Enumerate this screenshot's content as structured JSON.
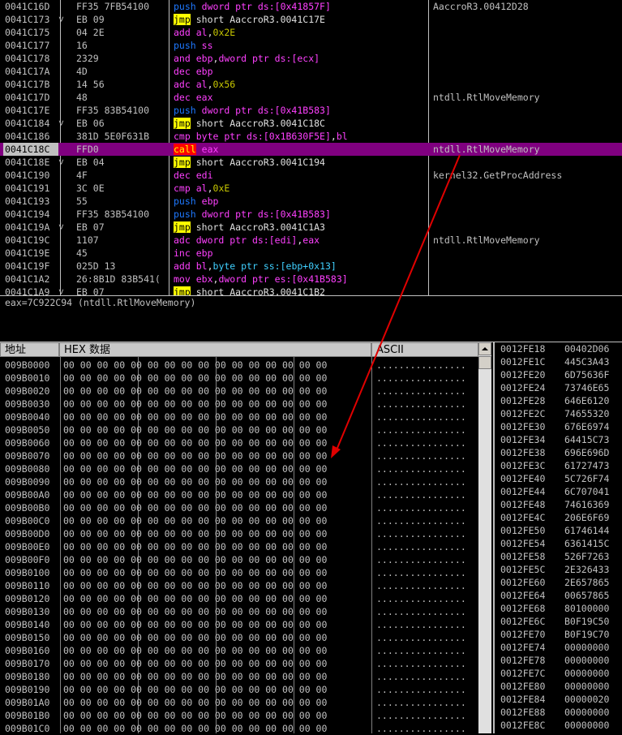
{
  "disasm": {
    "rows": [
      {
        "addr": "0041C16D",
        "mark": "",
        "hex": "FF35 7FB54100",
        "mn": "push",
        "mnc": "push",
        "ops": [
          [
            "mem",
            "dword ptr ds:[0x41857F]"
          ]
        ],
        "cmt": "AaccroR3.00412D28",
        "sel": false
      },
      {
        "addr": "0041C173",
        "mark": "˅",
        "hex": "EB 09",
        "mn": "jmp",
        "mnc": "jmp",
        "ops": [
          [
            "txt",
            "short AaccroR3.0041C17E"
          ]
        ],
        "cmt": "",
        "sel": false
      },
      {
        "addr": "0041C175",
        "mark": "",
        "hex": "04 2E",
        "mn": "add",
        "mnc": "",
        "ops": [
          [
            "reg",
            "al"
          ],
          [
            "txt",
            ","
          ],
          [
            "imm",
            "0x2E"
          ]
        ],
        "cmt": "",
        "sel": false
      },
      {
        "addr": "0041C177",
        "mark": "",
        "hex": "16",
        "mn": "push",
        "mnc": "push",
        "ops": [
          [
            "reg",
            "ss"
          ]
        ],
        "cmt": "",
        "sel": false
      },
      {
        "addr": "0041C178",
        "mark": "",
        "hex": "2329",
        "mn": "and",
        "mnc": "",
        "ops": [
          [
            "reg",
            "ebp"
          ],
          [
            "txt",
            ","
          ],
          [
            "mem",
            "dword ptr ds:[ecx]"
          ]
        ],
        "cmt": "",
        "sel": false
      },
      {
        "addr": "0041C17A",
        "mark": "",
        "hex": "4D",
        "mn": "dec",
        "mnc": "",
        "ops": [
          [
            "reg",
            "ebp"
          ]
        ],
        "cmt": "",
        "sel": false
      },
      {
        "addr": "0041C17B",
        "mark": "",
        "hex": "14 56",
        "mn": "adc",
        "mnc": "",
        "ops": [
          [
            "reg",
            "al"
          ],
          [
            "txt",
            ","
          ],
          [
            "imm",
            "0x56"
          ]
        ],
        "cmt": "",
        "sel": false
      },
      {
        "addr": "0041C17D",
        "mark": "",
        "hex": "48",
        "mn": "dec",
        "mnc": "",
        "ops": [
          [
            "reg",
            "eax"
          ]
        ],
        "cmt": "ntdll.RtlMoveMemory",
        "sel": false
      },
      {
        "addr": "0041C17E",
        "mark": "",
        "hex": "FF35 83B54100",
        "mn": "push",
        "mnc": "push",
        "ops": [
          [
            "mem",
            "dword ptr ds:[0x41B583]"
          ]
        ],
        "cmt": "",
        "sel": false
      },
      {
        "addr": "0041C184",
        "mark": "˅",
        "hex": "EB 06",
        "mn": "jmp",
        "mnc": "jmp",
        "ops": [
          [
            "txt",
            "short AaccroR3.0041C18C"
          ]
        ],
        "cmt": "",
        "sel": false
      },
      {
        "addr": "0041C186",
        "mark": "",
        "hex": "381D 5E0F631B",
        "mn": "cmp",
        "mnc": "",
        "ops": [
          [
            "mem",
            "byte ptr ds:[0x1B630F5E]"
          ],
          [
            "txt",
            ","
          ],
          [
            "reg",
            "bl"
          ]
        ],
        "cmt": "",
        "sel": false
      },
      {
        "addr": "0041C18C",
        "mark": "",
        "hex": "FFD0",
        "mn": "call",
        "mnc": "call",
        "ops": [
          [
            "reg",
            "eax"
          ]
        ],
        "cmt": "ntdll.RtlMoveMemory",
        "sel": true
      },
      {
        "addr": "0041C18E",
        "mark": "˅",
        "hex": "EB 04",
        "mn": "jmp",
        "mnc": "jmp",
        "ops": [
          [
            "txt",
            "short AaccroR3.0041C194"
          ]
        ],
        "cmt": "",
        "sel": false
      },
      {
        "addr": "0041C190",
        "mark": "",
        "hex": "4F",
        "mn": "dec",
        "mnc": "",
        "ops": [
          [
            "reg",
            "edi"
          ]
        ],
        "cmt": "kernel32.GetProcAddress",
        "sel": false
      },
      {
        "addr": "0041C191",
        "mark": "",
        "hex": "3C 0E",
        "mn": "cmp",
        "mnc": "",
        "ops": [
          [
            "reg",
            "al"
          ],
          [
            "txt",
            ","
          ],
          [
            "imm",
            "0xE"
          ]
        ],
        "cmt": "",
        "sel": false
      },
      {
        "addr": "0041C193",
        "mark": "",
        "hex": "55",
        "mn": "push",
        "mnc": "push",
        "ops": [
          [
            "reg",
            "ebp"
          ]
        ],
        "cmt": "",
        "sel": false
      },
      {
        "addr": "0041C194",
        "mark": "",
        "hex": "FF35 83B54100",
        "mn": "push",
        "mnc": "push",
        "ops": [
          [
            "mem",
            "dword ptr ds:[0x41B583]"
          ]
        ],
        "cmt": "",
        "sel": false
      },
      {
        "addr": "0041C19A",
        "mark": "˅",
        "hex": "EB 07",
        "mn": "jmp",
        "mnc": "jmp",
        "ops": [
          [
            "txt",
            "short AaccroR3.0041C1A3"
          ]
        ],
        "cmt": "",
        "sel": false
      },
      {
        "addr": "0041C19C",
        "mark": "",
        "hex": "1107",
        "mn": "adc",
        "mnc": "",
        "ops": [
          [
            "mem",
            "dword ptr ds:[edi]"
          ],
          [
            "txt",
            ","
          ],
          [
            "reg",
            "eax"
          ]
        ],
        "cmt": "ntdll.RtlMoveMemory",
        "sel": false
      },
      {
        "addr": "0041C19E",
        "mark": "",
        "hex": "45",
        "mn": "inc",
        "mnc": "",
        "ops": [
          [
            "reg",
            "ebp"
          ]
        ],
        "cmt": "",
        "sel": false
      },
      {
        "addr": "0041C19F",
        "mark": "",
        "hex": "025D 13",
        "mn": "add",
        "mnc": "",
        "ops": [
          [
            "reg",
            "bl"
          ],
          [
            "txt",
            ","
          ],
          [
            "cyan",
            "byte ptr ss:[ebp+0x13]"
          ]
        ],
        "cmt": "",
        "sel": false
      },
      {
        "addr": "0041C1A2",
        "mark": "",
        "hex": "26:8B1D 83B541(",
        "mn": "mov",
        "mnc": "",
        "ops": [
          [
            "reg",
            "ebx"
          ],
          [
            "txt",
            ","
          ],
          [
            "mem",
            "dword ptr es:[0x41B583]"
          ]
        ],
        "cmt": "",
        "sel": false
      },
      {
        "addr": "0041C1A9",
        "mark": "˅",
        "hex": "EB 07",
        "mn": "jmp",
        "mnc": "jmp",
        "ops": [
          [
            "txt",
            "short AaccroR3.0041C1B2"
          ]
        ],
        "cmt": "",
        "sel": false
      }
    ]
  },
  "info": {
    "text": "eax=7C922C94 (ntdll.RtlMoveMemory)"
  },
  "dump": {
    "header_address": "地址",
    "header_hex": "HEX 数据",
    "header_ascii": "ASCII",
    "row_bytes": "00 00 00 00 00 00 00 00 00 00 00 00 00 00 00 00",
    "row_ascii": "................",
    "addresses": [
      "009B0000",
      "009B0010",
      "009B0020",
      "009B0030",
      "009B0040",
      "009B0050",
      "009B0060",
      "009B0070",
      "009B0080",
      "009B0090",
      "009B00A0",
      "009B00B0",
      "009B00C0",
      "009B00D0",
      "009B00E0",
      "009B00F0",
      "009B0100",
      "009B0110",
      "009B0120",
      "009B0130",
      "009B0140",
      "009B0150",
      "009B0160",
      "009B0170",
      "009B0180",
      "009B0190",
      "009B01A0",
      "009B01B0",
      "009B01C0"
    ]
  },
  "stack": {
    "rows": [
      [
        "0012FE18",
        "00402D06"
      ],
      [
        "0012FE1C",
        "445C3A43"
      ],
      [
        "0012FE20",
        "6D75636F"
      ],
      [
        "0012FE24",
        "73746E65"
      ],
      [
        "0012FE28",
        "646E6120"
      ],
      [
        "0012FE2C",
        "74655320"
      ],
      [
        "0012FE30",
        "676E6974"
      ],
      [
        "0012FE34",
        "64415C73"
      ],
      [
        "0012FE38",
        "696E696D"
      ],
      [
        "0012FE3C",
        "61727473"
      ],
      [
        "0012FE40",
        "5C726F74"
      ],
      [
        "0012FE44",
        "6C707041"
      ],
      [
        "0012FE48",
        "74616369"
      ],
      [
        "0012FE4C",
        "206E6F69"
      ],
      [
        "0012FE50",
        "61746144"
      ],
      [
        "0012FE54",
        "6361415C"
      ],
      [
        "0012FE58",
        "526F7263"
      ],
      [
        "0012FE5C",
        "2E326433"
      ],
      [
        "0012FE60",
        "2E657865"
      ],
      [
        "0012FE64",
        "00657865"
      ],
      [
        "0012FE68",
        "80100000"
      ],
      [
        "0012FE6C",
        "B0F19C50"
      ],
      [
        "0012FE70",
        "B0F19C70"
      ],
      [
        "0012FE74",
        "00000000"
      ],
      [
        "0012FE78",
        "00000000"
      ],
      [
        "0012FE7C",
        "00000000"
      ],
      [
        "0012FE80",
        "00000000"
      ],
      [
        "0012FE84",
        "00000020"
      ],
      [
        "0012FE88",
        "00000000"
      ],
      [
        "0012FE8C",
        "00000000"
      ]
    ]
  },
  "colors": {
    "arrow": "#e00000"
  }
}
